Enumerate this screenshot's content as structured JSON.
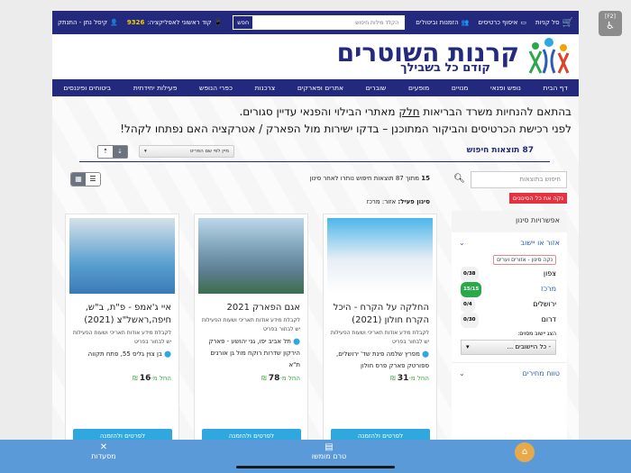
{
  "topbar": {
    "cart": "סל קניות",
    "cards": "איסוף כרטיסים",
    "orders": "הזמנות וביטולים",
    "search_placeholder": "הקלד מילות חיפוש",
    "search_button": "חפש",
    "app_code_label": "קוד ראשוני לאפליקציה:",
    "app_code": "9326",
    "user": "קיסל נתן - התנתק"
  },
  "logo": {
    "title": "קרנות השוטרים",
    "subtitle": "קודם כל בשבילך"
  },
  "nav": [
    "דף הבית",
    "נופש ופנאי",
    "מנויים",
    "מופעים",
    "שוברים",
    "אתרים ופארקים",
    "צרכנות",
    "כפרי הנופש",
    "פעילות יחידתית",
    "ביטוחים ופיננסים"
  ],
  "notice": {
    "line1_pre": "בהתאם להנחיות משרד הבריאות ",
    "line1_link": "חלק",
    "line1_post": " מאתרי הבילוי והפנאי עדיין סגורים.",
    "line2": "לפני רכישת הכרטיסים והביקור המתוכנן – בדקו ישירות מול הפארק / אטרקציה האם נפתחו לקהל!"
  },
  "results": {
    "count_label": "87 תוצאות חיפוש",
    "sort_select": "מיין לפי שם הפריט",
    "search_placeholder": "חיפוש בתוצאות",
    "clear_all": "נקה את כל הסינונים",
    "summary_num": "15",
    "summary": " מתוך 87 תוצאות חיפוש נותרו לאחר סינון",
    "active_label": "סינון פעיל:",
    "active_value": " אזור: מרכז"
  },
  "filters": {
    "title": "אפשרויות סינון",
    "section1": "אזור או יישוב",
    "clear_region": "נקה סינון - אזורים וערים",
    "regions": [
      {
        "name": "צפון",
        "count": "0/38"
      },
      {
        "name": "מרכז",
        "count": "15/15",
        "active": true
      },
      {
        "name": "ירושלים",
        "count": "0/4"
      },
      {
        "name": "דרום",
        "count": "0/30"
      }
    ],
    "city_label": "הצג יישוב מסוים:",
    "city_select": "- כל היישובים ...",
    "section2": "טווח מחירים"
  },
  "cards": [
    {
      "title": "החלקה על הקרח - היכל הקרח חולון (2021)",
      "desc": "לקבלת מידע אודות תאריכי ושעות הפעילות יש לבחור בפריט",
      "address": "מפרץ שלמה פינת שד' ירושלים, ספורטק פארק פרס חולון",
      "price_prefix": "החל מ-",
      "price": "31",
      "currency": "₪",
      "button": "לפרטים ולהזמנה"
    },
    {
      "title": "אגם הפארק 2021",
      "desc": "לקבלת מידע אודות תאריכי ושעות הפעילות יש לבחור בפריט",
      "address": "תל אביב יפו, גני יהושע - פארק הירקון שדרות רוקח מול גן אורנים ת\"א",
      "price_prefix": "החל מ-",
      "price": "78",
      "currency": "₪",
      "button": "לפרטים ולהזמנה"
    },
    {
      "title": "איי ג'אמפ - פ\"ת, ב\"ש, חיפה,ראשל\"צ (2021)",
      "desc": "לקבלת מידע אודות תאריכי ושעות הפעילות יש לבחור בפריט",
      "address": "בן צוין גליס 55, פתח תקווה",
      "price_prefix": "החל מ-",
      "price": "16",
      "currency": "₪",
      "button": "לפרטים ולהזמנה"
    }
  ],
  "bottom": {
    "restaurants": "מסעדות",
    "subsidized": "טרם מומשו"
  },
  "accessibility": {
    "key": "[F2]"
  },
  "colors": {
    "navy": "#232a7e",
    "red": "#e53240",
    "green": "#2aa84a",
    "blue": "#2fa8e0",
    "bottom": "#5a9ad8"
  }
}
